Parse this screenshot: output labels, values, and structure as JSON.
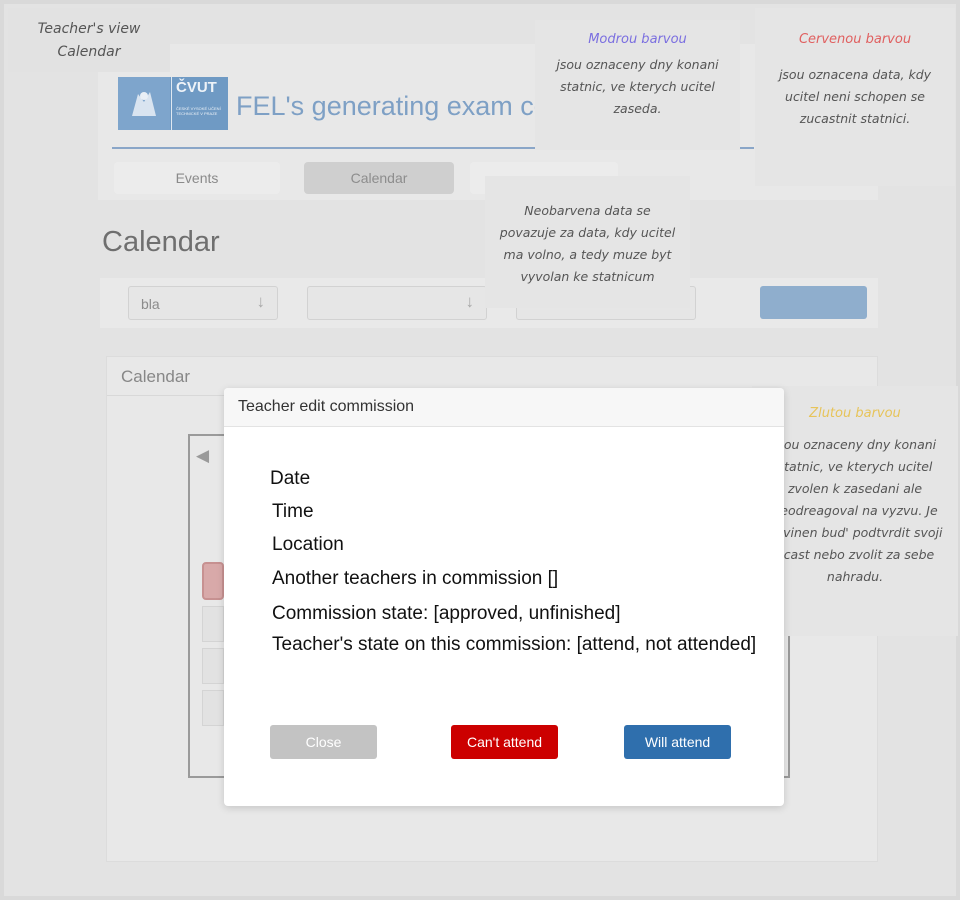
{
  "annotations": {
    "top_left": {
      "line1": "Teacher's view",
      "line2": "Calendar"
    },
    "blue": {
      "title": "Modrou barvou",
      "title_color": "#7b6fe0",
      "text": "jsou oznaceny dny konani statnic, ve kterych ucitel zaseda."
    },
    "red": {
      "title": "Cervenou barvou",
      "title_color": "#e06060",
      "text": "jsou oznacena data, kdy ucitel neni schopen se zucastnit statnici."
    },
    "uncolored": {
      "text": "Neobarvena data se povazuje za data, kdy ucitel ma volno, a tedy muze byt vyvolan ke statnicum"
    },
    "yellow": {
      "title": "Zlutou barvou",
      "title_color": "#e7c45a",
      "text": "jsou oznaceny dny konani statnic, ve kterych ucitel zvolen k zasedani ale neodreagoval na vyzvu. Je povinen bud' podtvrdit svoji ucast nebo zvolit za sebe nahradu."
    }
  },
  "app": {
    "logo_text": "ČVUT",
    "logo_small": "ČESKÉ VYSOKÉ UČENÍ TECHNICKÉ V PRAZE",
    "title": "FEL's generating exam co"
  },
  "nav": {
    "tabs": [
      {
        "label": "Events"
      },
      {
        "label": "Calendar",
        "active": true
      },
      {
        "label": ""
      }
    ]
  },
  "page": {
    "heading": "Calendar"
  },
  "filters": {
    "select1": "bla",
    "select2": "",
    "select3": ""
  },
  "calendar": {
    "panel_title": "Calendar"
  },
  "modal": {
    "title": "Teacher edit commission",
    "fields": {
      "date": "Date",
      "time": "Time",
      "location": "Location",
      "others": "Another teachers in commission []",
      "commission_state": "Commission state: [approved, unfinished]",
      "teacher_state": "Teacher's state on this commission: [attend, not attended]"
    },
    "buttons": {
      "close": "Close",
      "cant": "Can't attend",
      "will": "Will attend"
    }
  },
  "colors": {
    "accent": "#2f6fad",
    "danger": "#cc0000",
    "disabled": "#c3c3c3"
  }
}
